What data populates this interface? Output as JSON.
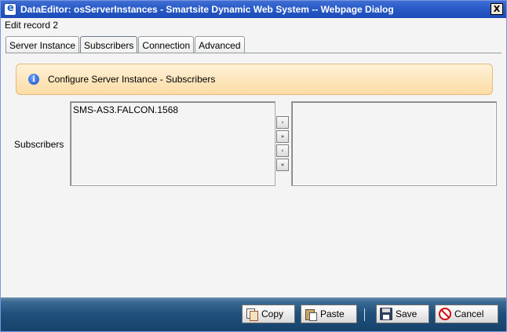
{
  "window": {
    "title": "DataEditor: osServerInstances - Smartsite Dynamic Web System -- Webpage Dialog",
    "close_label": "X"
  },
  "edit_record": "Edit record 2",
  "tabs": [
    {
      "label": "Server Instance",
      "active": false
    },
    {
      "label": "Subscribers",
      "active": true
    },
    {
      "label": "Connection",
      "active": false
    },
    {
      "label": "Advanced",
      "active": false
    }
  ],
  "info": {
    "icon": "info-icon",
    "text": "Configure Server Instance - Subscribers"
  },
  "subscribers": {
    "label": "Subscribers",
    "available": [
      "SMS-AS3.FALCON.1568"
    ],
    "selected": []
  },
  "arrows": [
    "›",
    "»",
    "‹",
    "«"
  ],
  "footer": {
    "copy": "Copy",
    "paste": "Paste",
    "save": "Save",
    "cancel": "Cancel"
  }
}
